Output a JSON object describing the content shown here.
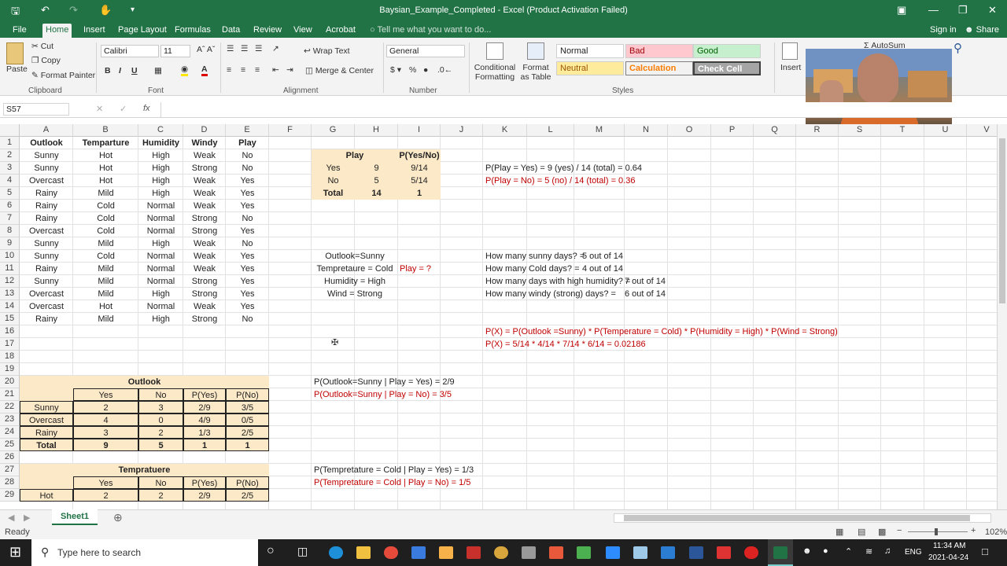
{
  "window": {
    "title": "Baysian_Example_Completed - Excel (Product Activation Failed)"
  },
  "ribbon": {
    "tabs": [
      "File",
      "Home",
      "Insert",
      "Page Layout",
      "Formulas",
      "Data",
      "Review",
      "View",
      "Acrobat"
    ],
    "tell_me": "Tell me what you want to do...",
    "sign_in": "Sign in",
    "share": "Share",
    "clipboard": {
      "paste": "Paste",
      "cut": "Cut",
      "copy": "Copy",
      "format_painter": "Format Painter",
      "label": "Clipboard"
    },
    "font": {
      "name": "Calibri",
      "size": "11",
      "label": "Font"
    },
    "alignment": {
      "wrap": "Wrap Text",
      "merge": "Merge & Center",
      "label": "Alignment"
    },
    "number": {
      "format": "General",
      "label": "Number"
    },
    "styles": {
      "conditional": "Conditional Formatting",
      "format_table": "Format as Table",
      "normal": "Normal",
      "bad": "Bad",
      "good": "Good",
      "neutral": "Neutral",
      "calculation": "Calculation",
      "check_cell": "Check Cell",
      "label": "Styles"
    },
    "cells": {
      "insert": "Insert"
    },
    "editing": {
      "autosum": "AutoSum"
    }
  },
  "formula_bar": {
    "name_box": "S57",
    "fx": "fx",
    "value": ""
  },
  "columns": [
    "A",
    "B",
    "C",
    "D",
    "E",
    "F",
    "G",
    "H",
    "I",
    "J",
    "K",
    "L",
    "M",
    "N",
    "O",
    "P",
    "Q",
    "R",
    "S",
    "T",
    "U",
    "V"
  ],
  "rows": [
    "1",
    "2",
    "3",
    "4",
    "5",
    "6",
    "7",
    "8",
    "9",
    "10",
    "11",
    "12",
    "13",
    "14",
    "15",
    "16",
    "17",
    "18",
    "19",
    "20",
    "21",
    "22",
    "23",
    "24",
    "25",
    "26",
    "27",
    "28",
    "29"
  ],
  "dataset": {
    "headers": [
      "Outlook",
      "Temparture",
      "Humidity",
      "Windy",
      "Play"
    ],
    "rows": [
      [
        "Sunny",
        "Hot",
        "High",
        "Weak",
        "No"
      ],
      [
        "Sunny",
        "Hot",
        "High",
        "Strong",
        "No"
      ],
      [
        "Overcast",
        "Hot",
        "High",
        "Weak",
        "Yes"
      ],
      [
        "Rainy",
        "Mild",
        "High",
        "Weak",
        "Yes"
      ],
      [
        "Rainy",
        "Cold",
        "Normal",
        "Weak",
        "Yes"
      ],
      [
        "Rainy",
        "Cold",
        "Normal",
        "Strong",
        "No"
      ],
      [
        "Overcast",
        "Cold",
        "Normal",
        "Strong",
        "Yes"
      ],
      [
        "Sunny",
        "Mild",
        "High",
        "Weak",
        "No"
      ],
      [
        "Sunny",
        "Cold",
        "Normal",
        "Weak",
        "Yes"
      ],
      [
        "Rainy",
        "Mild",
        "Normal",
        "Weak",
        "Yes"
      ],
      [
        "Sunny",
        "Mild",
        "Normal",
        "Strong",
        "Yes"
      ],
      [
        "Overcast",
        "Mild",
        "High",
        "Strong",
        "Yes"
      ],
      [
        "Overcast",
        "Hot",
        "Normal",
        "Weak",
        "Yes"
      ],
      [
        "Rainy",
        "Mild",
        "High",
        "Strong",
        "No"
      ]
    ]
  },
  "play_table": {
    "h1": "Play",
    "h2": "P(Yes/No)",
    "rows": [
      [
        "Yes",
        "9",
        "9/14"
      ],
      [
        "No",
        "5",
        "5/14"
      ],
      [
        "Total",
        "14",
        "1"
      ]
    ]
  },
  "notes": {
    "p_yes": "P(Play = Yes) =  9 (yes) / 14 (total) = 0.64",
    "p_no": "P(Play = No) =  5 (no) / 14 (total) = 0.36",
    "q_outlook": "Outlook=Sunny",
    "q_temp": "Tempretaure = Cold",
    "q_hum": "Humidity = High",
    "q_wind": "Wind = Strong",
    "play_q": "Play = ?",
    "sunny_q": "How many sunny days? =",
    "sunny_a": "5 out of 14",
    "cold_q": "How many Cold days? =",
    "cold_a": "4 out of 14",
    "hum_q": "How many days with high humidity? =",
    "hum_a": "7 out of 14",
    "wind_q": "How many windy (strong) days? =",
    "wind_a": "6 out of 14",
    "px1": "P(X) = P(Outlook =Sunny) * P(Temperature = Cold) * P(Humidity = High) * P(Wind = Strong)",
    "px2": "P(X) = 5/14 * 4/14 * 7/14 * 6/14 = 0.02186",
    "o_yes": "P(Outlook=Sunny | Play = Yes) = 2/9",
    "o_no": "P(Outlook=Sunny | Play = No) = 3/5",
    "t_yes": "P(Tempretature = Cold | Play = Yes) = 1/3",
    "t_no": "P(Tempretature = Cold | Play = No) = 1/5"
  },
  "outlook_table": {
    "title": "Outlook",
    "headers": [
      "Yes",
      "No",
      "P(Yes)",
      "P(No)"
    ],
    "rows": [
      [
        "Sunny",
        "2",
        "3",
        "2/9",
        "3/5"
      ],
      [
        "Overcast",
        "4",
        "0",
        "4/9",
        "0/5"
      ],
      [
        "Rainy",
        "3",
        "2",
        "1/3",
        "2/5"
      ],
      [
        "Total",
        "9",
        "5",
        "1",
        "1"
      ]
    ]
  },
  "temp_table": {
    "title": "Tempratuere",
    "headers": [
      "Yes",
      "No",
      "P(Yes)",
      "P(No)"
    ],
    "rows": [
      [
        "Hot",
        "2",
        "2",
        "2/9",
        "2/5"
      ]
    ]
  },
  "sheet_tab": "Sheet1",
  "status": {
    "ready": "Ready",
    "zoom": "102%"
  },
  "taskbar": {
    "search": "Type here to search",
    "lang": "ENG",
    "time": "11:34 AM",
    "date": "2021-04-24"
  }
}
